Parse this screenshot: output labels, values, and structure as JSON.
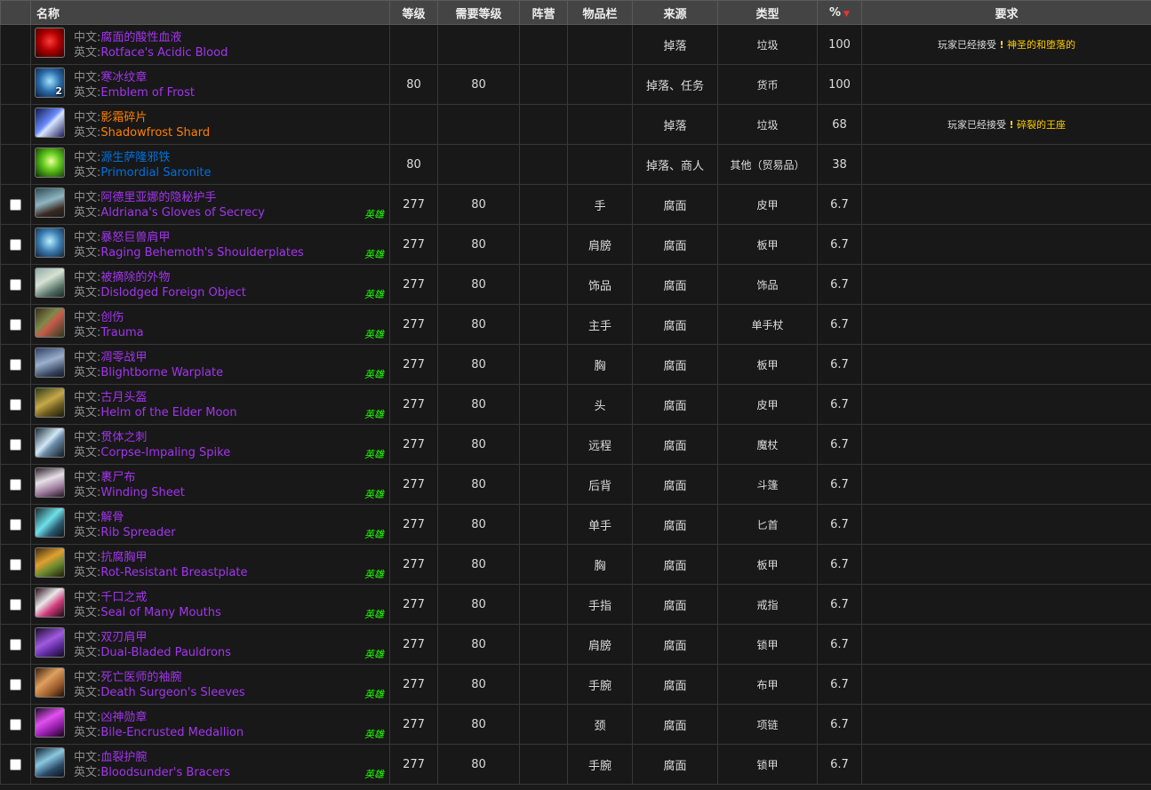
{
  "columns": {
    "name": "名称",
    "level": "等级",
    "req_level": "需要等级",
    "faction": "阵营",
    "slot": "物品栏",
    "source": "来源",
    "type": "类型",
    "pct": "%",
    "requirement": "要求"
  },
  "labels": {
    "cn": "中文:",
    "en": "英文:",
    "heroic": "英雄"
  },
  "quality_colors": {
    "epic": "#a335ee",
    "legendary": "#ff8000",
    "rare": "#0070dd",
    "gray_label": "#8c8c8c",
    "heroic": "#1eff00"
  },
  "items": [
    {
      "cn": "腐面的酸性血液",
      "en": "Rotface's Acidic Blood",
      "icon": "red-blood-flask-icon",
      "level": "",
      "req_level": "",
      "faction": "",
      "slot": "",
      "source": "掉落",
      "type": "垃圾",
      "pct": "100",
      "req_text": "玩家已经接受",
      "req_quest": "神圣的和堕落的",
      "heroic": false,
      "checkbox": false
    },
    {
      "cn": "寒冰纹章",
      "en": "Emblem of Frost",
      "icon": "frost-emblem-icon",
      "stack": "2",
      "level": "80",
      "req_level": "80",
      "faction": "",
      "slot": "",
      "source": "掉落、任务",
      "type": "货币",
      "pct": "100",
      "req_text": "",
      "req_quest": "",
      "heroic": false,
      "checkbox": false
    },
    {
      "cn": "影霜碎片",
      "en": "Shadowfrost Shard",
      "icon": "shadowfrost-shard-icon",
      "level": "",
      "req_level": "",
      "faction": "",
      "slot": "",
      "source": "掉落",
      "type": "垃圾",
      "pct": "68",
      "req_text": "玩家已经接受",
      "req_quest": "碎裂的王座",
      "heroic": false,
      "checkbox": false
    },
    {
      "cn": "源生萨隆邪铁",
      "en": "Primordial Saronite",
      "icon": "saronite-icon",
      "level": "80",
      "req_level": "",
      "faction": "",
      "slot": "",
      "source": "掉落、商人",
      "type": "其他（贸易品）",
      "pct": "38",
      "req_text": "",
      "req_quest": "",
      "heroic": false,
      "checkbox": false
    },
    {
      "cn": "阿德里亚娜的隐秘护手",
      "en": "Aldriana's Gloves of Secrecy",
      "icon": "gloves-icon",
      "level": "277",
      "req_level": "80",
      "faction": "",
      "slot": "手",
      "source": "腐面",
      "type": "皮甲",
      "pct": "6.7",
      "req_text": "",
      "req_quest": "",
      "heroic": true,
      "checkbox": true
    },
    {
      "cn": "暴怒巨兽肩甲",
      "en": "Raging Behemoth's Shoulderplates",
      "icon": "shoulderplates-icon",
      "level": "277",
      "req_level": "80",
      "faction": "",
      "slot": "肩膀",
      "source": "腐面",
      "type": "板甲",
      "pct": "6.7",
      "req_text": "",
      "req_quest": "",
      "heroic": true,
      "checkbox": true
    },
    {
      "cn": "被摘除的外物",
      "en": "Dislodged Foreign Object",
      "icon": "trinket-icon",
      "level": "277",
      "req_level": "80",
      "faction": "",
      "slot": "饰品",
      "source": "腐面",
      "type": "饰品",
      "pct": "6.7",
      "req_text": "",
      "req_quest": "",
      "heroic": true,
      "checkbox": true
    },
    {
      "cn": "创伤",
      "en": "Trauma",
      "icon": "mace-icon",
      "level": "277",
      "req_level": "80",
      "faction": "",
      "slot": "主手",
      "source": "腐面",
      "type": "单手杖",
      "pct": "6.7",
      "req_text": "",
      "req_quest": "",
      "heroic": true,
      "checkbox": true
    },
    {
      "cn": "凋零战甲",
      "en": "Blightborne Warplate",
      "icon": "chest-plate-icon",
      "level": "277",
      "req_level": "80",
      "faction": "",
      "slot": "胸",
      "source": "腐面",
      "type": "板甲",
      "pct": "6.7",
      "req_text": "",
      "req_quest": "",
      "heroic": true,
      "checkbox": true
    },
    {
      "cn": "古月头盔",
      "en": "Helm of the Elder Moon",
      "icon": "helm-icon",
      "level": "277",
      "req_level": "80",
      "faction": "",
      "slot": "头",
      "source": "腐面",
      "type": "皮甲",
      "pct": "6.7",
      "req_text": "",
      "req_quest": "",
      "heroic": true,
      "checkbox": true
    },
    {
      "cn": "贯体之刺",
      "en": "Corpse-Impaling Spike",
      "icon": "wand-icon",
      "level": "277",
      "req_level": "80",
      "faction": "",
      "slot": "远程",
      "source": "腐面",
      "type": "魔杖",
      "pct": "6.7",
      "req_text": "",
      "req_quest": "",
      "heroic": true,
      "checkbox": true
    },
    {
      "cn": "裹尸布",
      "en": "Winding Sheet",
      "icon": "cloak-icon",
      "level": "277",
      "req_level": "80",
      "faction": "",
      "slot": "后背",
      "source": "腐面",
      "type": "斗篷",
      "pct": "6.7",
      "req_text": "",
      "req_quest": "",
      "heroic": true,
      "checkbox": true
    },
    {
      "cn": "解骨",
      "en": "Rib Spreader",
      "icon": "dagger-icon",
      "level": "277",
      "req_level": "80",
      "faction": "",
      "slot": "单手",
      "source": "腐面",
      "type": "匕首",
      "pct": "6.7",
      "req_text": "",
      "req_quest": "",
      "heroic": true,
      "checkbox": true
    },
    {
      "cn": "抗腐胸甲",
      "en": "Rot-Resistant Breastplate",
      "icon": "breastplate-icon",
      "level": "277",
      "req_level": "80",
      "faction": "",
      "slot": "胸",
      "source": "腐面",
      "type": "板甲",
      "pct": "6.7",
      "req_text": "",
      "req_quest": "",
      "heroic": true,
      "checkbox": true
    },
    {
      "cn": "千口之戒",
      "en": "Seal of Many Mouths",
      "icon": "ring-icon",
      "level": "277",
      "req_level": "80",
      "faction": "",
      "slot": "手指",
      "source": "腐面",
      "type": "戒指",
      "pct": "6.7",
      "req_text": "",
      "req_quest": "",
      "heroic": true,
      "checkbox": true
    },
    {
      "cn": "双刃肩甲",
      "en": "Dual-Bladed Pauldrons",
      "icon": "pauldrons-icon",
      "level": "277",
      "req_level": "80",
      "faction": "",
      "slot": "肩膀",
      "source": "腐面",
      "type": "锁甲",
      "pct": "6.7",
      "req_text": "",
      "req_quest": "",
      "heroic": true,
      "checkbox": true
    },
    {
      "cn": "死亡医师的袖腕",
      "en": "Death Surgeon's Sleeves",
      "icon": "sleeves-icon",
      "level": "277",
      "req_level": "80",
      "faction": "",
      "slot": "手腕",
      "source": "腐面",
      "type": "布甲",
      "pct": "6.7",
      "req_text": "",
      "req_quest": "",
      "heroic": true,
      "checkbox": true
    },
    {
      "cn": "凶神勋章",
      "en": "Bile-Encrusted Medallion",
      "icon": "medallion-icon",
      "level": "277",
      "req_level": "80",
      "faction": "",
      "slot": "颈",
      "source": "腐面",
      "type": "项链",
      "pct": "6.7",
      "req_text": "",
      "req_quest": "",
      "heroic": true,
      "checkbox": true
    },
    {
      "cn": "血裂护腕",
      "en": "Bloodsunder's Bracers",
      "icon": "bracers-icon",
      "level": "277",
      "req_level": "80",
      "faction": "",
      "slot": "手腕",
      "source": "腐面",
      "type": "锁甲",
      "pct": "6.7",
      "req_text": "",
      "req_quest": "",
      "heroic": true,
      "checkbox": true
    }
  ]
}
